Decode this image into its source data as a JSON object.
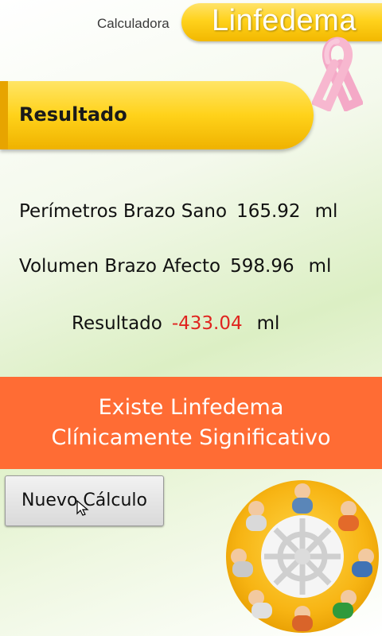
{
  "header": {
    "subtitle": "Calculadora",
    "title": "Linfedema"
  },
  "result_tab": {
    "label": "Resultado"
  },
  "results": {
    "line1": {
      "label": "Perímetros Brazo Sano",
      "value": "165.92",
      "unit": "ml"
    },
    "line2": {
      "label": "Volumen Brazo Afecto",
      "value": "598.96",
      "unit": "ml"
    },
    "line3": {
      "label": "Resultado",
      "value": "-433.04",
      "unit": "ml"
    }
  },
  "verdict": {
    "line1": "Existe Linfedema",
    "line2": "Clínicamente Significativo"
  },
  "button": {
    "new_calc": "Nuevo Cálculo"
  },
  "icons": [
    "pink-ribbon-icon",
    "cursor-icon",
    "team-circle-icon"
  ],
  "colors": {
    "accent_yellow": "#ffd21c",
    "verdict_orange": "#ff6c34",
    "negative_red": "#e0241f",
    "ribbon_pink": "#f7b7cf"
  }
}
